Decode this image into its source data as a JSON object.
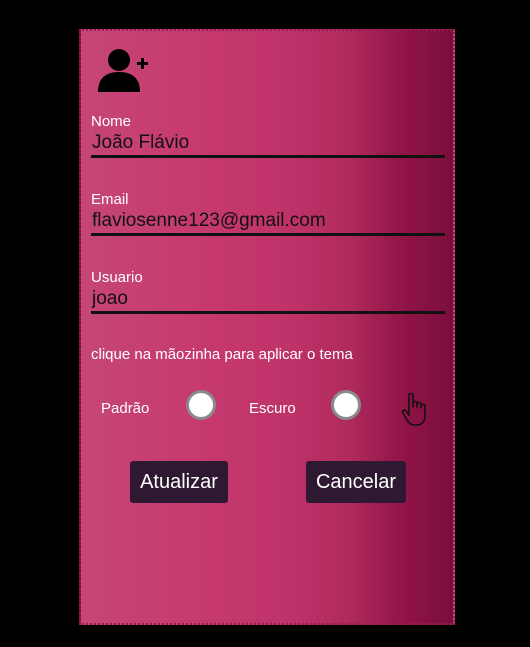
{
  "form": {
    "fields": [
      {
        "label": "Nome",
        "value": "João Flávio"
      },
      {
        "label": "Email",
        "value": "flaviosenne123@gmail.com"
      },
      {
        "label": "Usuario",
        "value": "joao"
      }
    ],
    "theme_hint": "clique na mãozinha para aplicar o tema",
    "themes": [
      {
        "label": "Padrão"
      },
      {
        "label": "Escuro"
      }
    ],
    "buttons": {
      "update": "Atualizar",
      "cancel": "Cancelar"
    }
  },
  "icons": {
    "avatar": "user-plus-icon",
    "apply_theme": "pointing-hand-icon"
  },
  "colors": {
    "background": "#000000",
    "card_gradient_start": "#c54677",
    "card_gradient_end": "#7a0e3c",
    "button_bg": "#2e1832",
    "button_text": "#ffffff",
    "label_text": "#ffffff",
    "value_text": "#111111"
  }
}
